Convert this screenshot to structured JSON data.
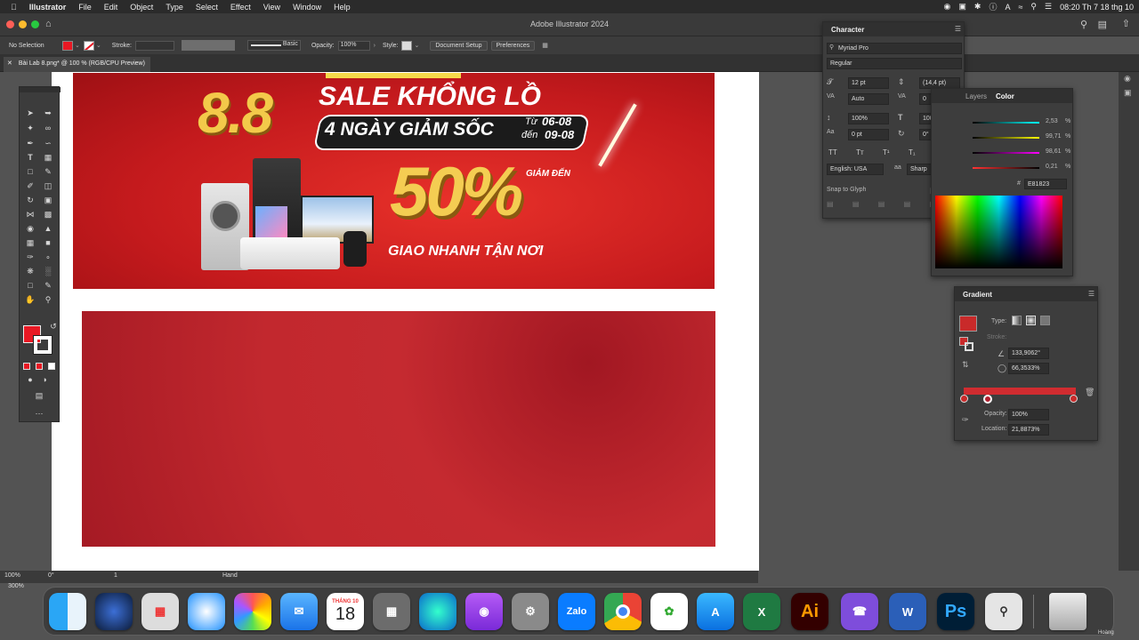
{
  "menubar": {
    "app_name": "Illustrator",
    "items": [
      "File",
      "Edit",
      "Object",
      "Type",
      "Select",
      "Effect",
      "View",
      "Window",
      "Help"
    ],
    "clock": "08:20 Th 7 18 thg 10"
  },
  "window": {
    "title": "Adobe Illustrator 2024"
  },
  "control_bar": {
    "selection": "No Selection",
    "stroke_label": "Stroke:",
    "stroke_style": "Basic",
    "opacity_label": "Opacity:",
    "opacity_value": "100%",
    "style_label": "Style:",
    "document_setup": "Document Setup",
    "preferences": "Preferences"
  },
  "document": {
    "tab_title": "Bài Lab 8.png* @ 100 % (RGB/CPU Preview)"
  },
  "banner": {
    "big_number": "8.8",
    "headline": "SALE KHỔNG LỒ",
    "badge_days": "4 NGÀY GIẢM SỐC",
    "from_label": "Từ",
    "date_from": "06-08",
    "to_label": "đến",
    "date_to": "09-08",
    "discount_prefix": "GIẢM ĐẾN",
    "discount_value": "50%",
    "footer": "GIAO NHANH TẬN NƠI"
  },
  "character_panel": {
    "title": "Character",
    "search_value": "Myriad Pro",
    "style_value": "Regular",
    "font_size": "12 pt",
    "leading": "(14,4 pt)",
    "kerning": "Auto",
    "tracking": "0",
    "vertical_scale": "100%",
    "horizontal_scale": "100%",
    "baseline_shift": "0 pt",
    "rotation": "0°",
    "language": "English: USA",
    "antialias": "Sharp",
    "snap_label": "Snap to Glyph"
  },
  "color_panel": {
    "tab_layers": "Layers",
    "tab_color": "Color",
    "values": [
      "2,53",
      "99,71",
      "98,61",
      "0,21"
    ],
    "percent_sign": "%",
    "hash": "#",
    "hex": "E81823"
  },
  "gradient_panel": {
    "title": "Gradient",
    "type_label": "Type:",
    "stroke_label": "Stroke:",
    "angle": "133,9062°",
    "aspect": "66,3533%",
    "opacity_label": "Opacity:",
    "opacity_value": "100%",
    "location_label": "Location:",
    "location_value": "21,8873%"
  },
  "status_bar": {
    "zoom": "100%",
    "rotation": "0°",
    "artboard": "1",
    "tool": "Hand",
    "zoom_small": "300%"
  },
  "dock": {
    "calendar_month": "THÁNG 10",
    "calendar_day": "18",
    "zalo_label": "Zalo",
    "illustrator_label": "Ai",
    "photoshop_label": "Ps",
    "word_label": "W",
    "excel_label": "X",
    "user_label": "Hoàng"
  },
  "colors": {
    "fill": "#e81823",
    "banner_red": "#c41a1d",
    "rect_red": "#c2282e",
    "gold": "#f3c94a"
  }
}
